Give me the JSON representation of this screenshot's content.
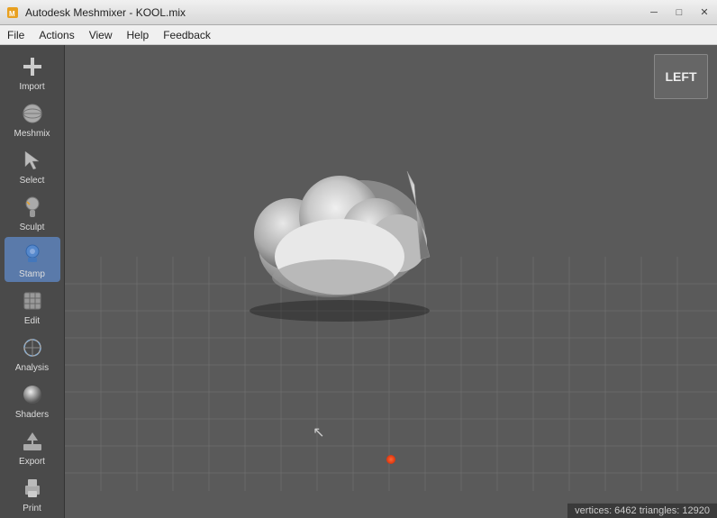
{
  "window": {
    "title": "Autodesk Meshmixer - KOOL.mix",
    "icon": "meshmixer-icon"
  },
  "titlebar": {
    "minimize_label": "─",
    "maximize_label": "□",
    "close_label": "✕"
  },
  "menubar": {
    "items": [
      {
        "id": "file",
        "label": "File"
      },
      {
        "id": "actions",
        "label": "Actions"
      },
      {
        "id": "view",
        "label": "View"
      },
      {
        "id": "help",
        "label": "Help"
      },
      {
        "id": "feedback",
        "label": "Feedback"
      }
    ]
  },
  "sidebar": {
    "tools": [
      {
        "id": "import",
        "label": "Import",
        "icon": "plus-icon"
      },
      {
        "id": "meshmix",
        "label": "Meshmix",
        "icon": "sphere-icon"
      },
      {
        "id": "select",
        "label": "Select",
        "icon": "cursor-icon"
      },
      {
        "id": "sculpt",
        "label": "Sculpt",
        "icon": "sculpt-icon"
      },
      {
        "id": "stamp",
        "label": "Stamp",
        "icon": "stamp-icon",
        "active": true
      },
      {
        "id": "edit",
        "label": "Edit",
        "icon": "edit-icon"
      },
      {
        "id": "analysis",
        "label": "Analysis",
        "icon": "analysis-icon"
      },
      {
        "id": "shaders",
        "label": "Shaders",
        "icon": "shaders-icon"
      },
      {
        "id": "export",
        "label": "Export",
        "icon": "export-icon"
      },
      {
        "id": "print",
        "label": "Print",
        "icon": "print-icon"
      }
    ]
  },
  "viewport": {
    "view_label": "LEFT",
    "status": "vertices: 6462  triangles: 12920"
  }
}
